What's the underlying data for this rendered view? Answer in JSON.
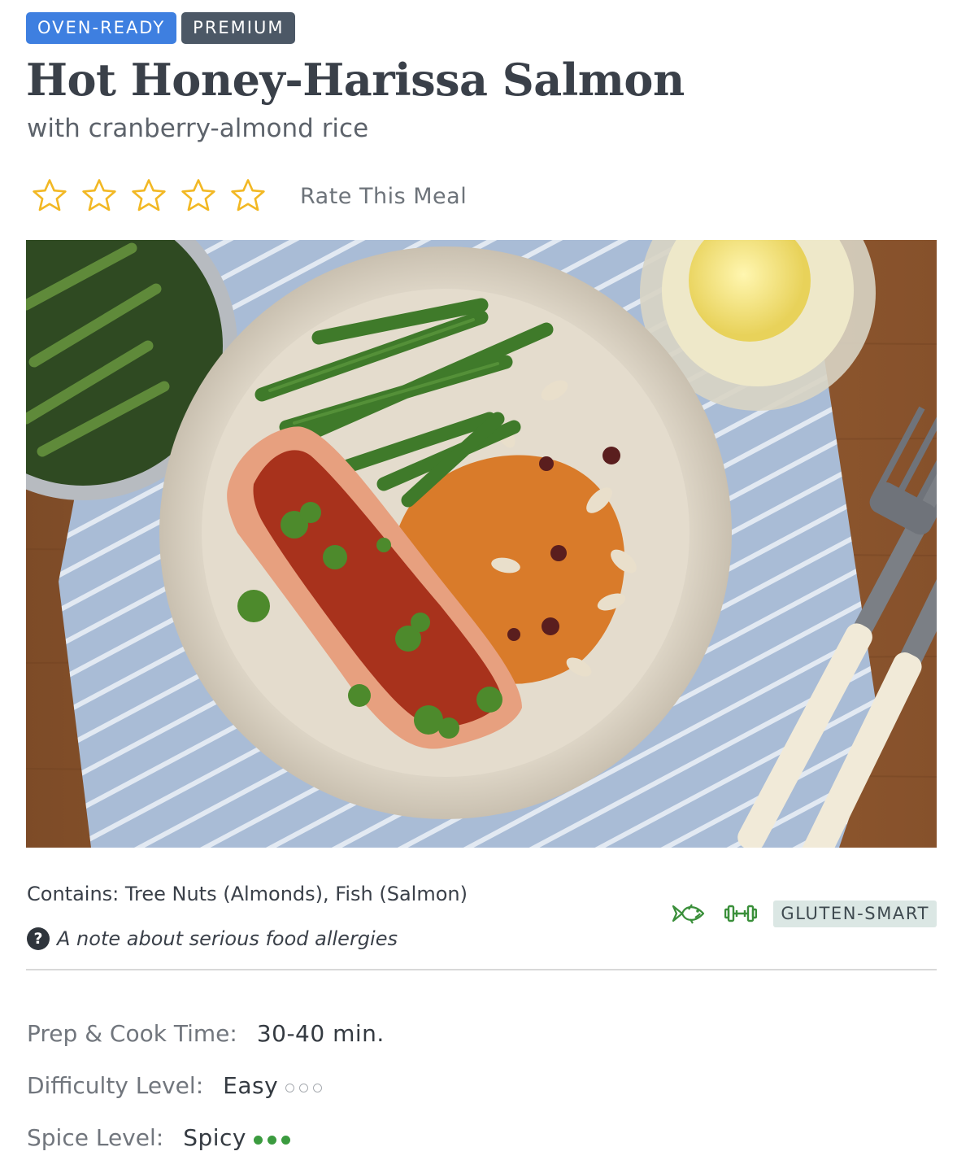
{
  "tags": [
    "OVEN-READY",
    "PREMIUM"
  ],
  "meal": {
    "title": "Hot Honey-Harissa Salmon",
    "subtitle": "with cranberry-almond rice"
  },
  "rating": {
    "star_count": 5,
    "value": 0,
    "label": "Rate This Meal",
    "star_color": "#f2b824"
  },
  "hero_image": {
    "subject": "plated salmon with green beans and cranberry-almond rice"
  },
  "allergens": {
    "text": "Contains: Tree Nuts (Almonds), Fish (Salmon)",
    "note": "A note about serious food allergies",
    "note_icon": "question-circle-icon"
  },
  "diet": {
    "icons": [
      "fish-icon",
      "dumbbell-icon"
    ],
    "badge": "GLUTEN-SMART",
    "icon_color": "#3a8f3a",
    "badge_bg": "#dbe7e4"
  },
  "details": {
    "prep": {
      "label": "Prep & Cook Time:",
      "value": "30-40 min."
    },
    "difficulty": {
      "label": "Difficulty Level:",
      "value": "Easy",
      "level": 0,
      "max": 3
    },
    "spice": {
      "label": "Spice Level:",
      "value": "Spicy",
      "level": 3,
      "max": 3
    }
  },
  "colors": {
    "oven_tag": "#3e7fe0",
    "premium_tag": "#4c5866",
    "spice_dot": "#3b9b3f"
  }
}
